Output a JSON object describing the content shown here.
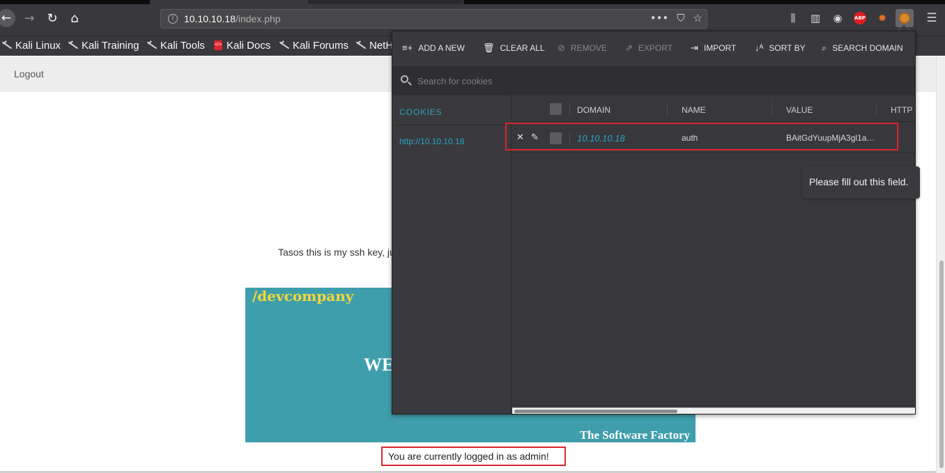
{
  "browser": {
    "url_host": "10.10.10.18",
    "url_path": "/index.php",
    "url_actions": [
      "•••",
      "⛉",
      "☆"
    ],
    "bookmarks": [
      "Kali Linux",
      "Kali Training",
      "Kali Tools",
      "Kali Docs",
      "Kali Forums",
      "NetH"
    ],
    "abp_label": "ABP"
  },
  "page": {
    "logout": "Logout",
    "ssh_text": "Tasos this is my ssh key, ju",
    "banner_brand": "/devcompany",
    "banner_we": "WE",
    "banner_tagline": "The Software Factory",
    "logged_in": "You are currently logged in as admin!"
  },
  "cookie_editor": {
    "toolbar": {
      "add": "ADD A NEW",
      "clear": "CLEAR ALL",
      "remove": "REMOVE",
      "export": "EXPORT",
      "import": "IMPORT",
      "sort": "SORT BY",
      "search_domain": "SEARCH DOMAIN"
    },
    "search_placeholder": "Search for cookies",
    "sidebar_title": "COOKIES",
    "sidebar_item": "http://10.10.10.18",
    "columns": [
      "DOMAIN",
      "NAME",
      "VALUE",
      "HTTP"
    ],
    "rows": [
      {
        "domain": "10.10.10.18",
        "name": "auth",
        "value": "BAitGdYuupMjA3gl1a…"
      }
    ]
  },
  "tooltip": "Please fill out this field.",
  "colors": {
    "accent": "#27a5c4",
    "highlight_border": "#d9262c",
    "banner_bg": "#3f9eac",
    "brand_yellow": "#f4d73a"
  }
}
